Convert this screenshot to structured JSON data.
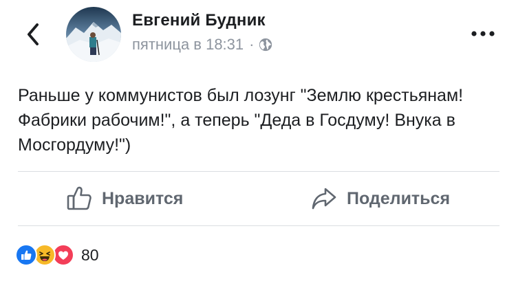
{
  "header": {
    "author_name": "Евгений Будник",
    "timestamp": "пятница в 18:31",
    "separator": "·",
    "privacy_icon": "globe-icon",
    "back_icon": "chevron-left-icon",
    "more_icon": "more-horizontal-icon"
  },
  "post": {
    "text": "Раньше у коммунистов был лозунг \"Землю крестьянам! Фабрики рабочим!\", а теперь \"Деда в Госдуму! Внука в Мосгордуму!\")"
  },
  "actions": {
    "like_label": "Нравится",
    "like_icon": "thumbs-up-icon",
    "share_label": "Поделиться",
    "share_icon": "share-arrow-icon"
  },
  "reactions": {
    "icons": [
      "like-reaction-icon",
      "haha-reaction-icon",
      "love-reaction-icon"
    ],
    "count": "80"
  },
  "colors": {
    "text_primary": "#1c1e21",
    "text_secondary": "#8d949e",
    "action_gray": "#606770",
    "like_blue": "#1877f2",
    "haha_yellow": "#f7b928",
    "love_red": "#f33e58",
    "divider": "#dadde1"
  }
}
